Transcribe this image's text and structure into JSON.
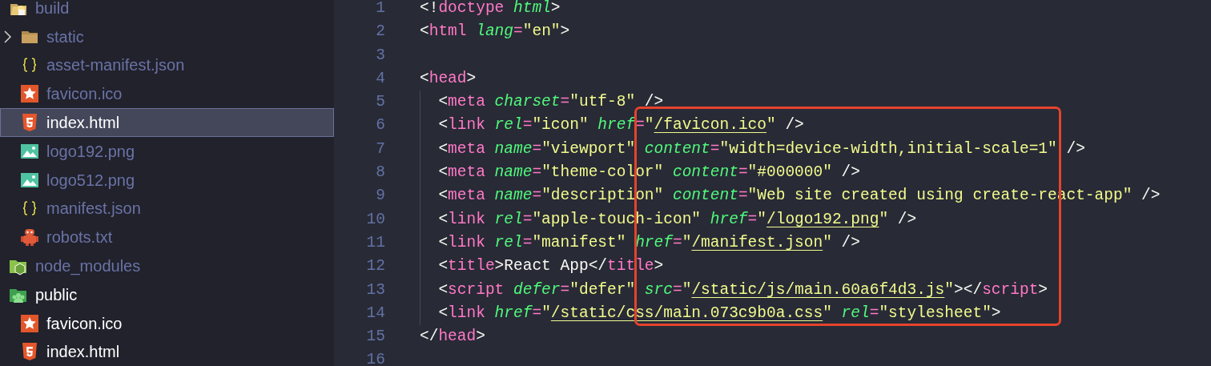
{
  "sidebar": {
    "items": [
      {
        "label": "build",
        "kind": "build-folder",
        "dimmed": true,
        "selected": false,
        "children": [
          {
            "label": "static",
            "kind": "folder",
            "dimmed": true,
            "selected": false,
            "expanded": false
          },
          {
            "label": "asset-manifest.json",
            "kind": "json",
            "dimmed": true,
            "selected": false
          },
          {
            "label": "favicon.ico",
            "kind": "star",
            "dimmed": true,
            "selected": false
          },
          {
            "label": "index.html",
            "kind": "html",
            "dimmed": false,
            "selected": true
          },
          {
            "label": "logo192.png",
            "kind": "image",
            "dimmed": true,
            "selected": false
          },
          {
            "label": "logo512.png",
            "kind": "image",
            "dimmed": true,
            "selected": false
          },
          {
            "label": "manifest.json",
            "kind": "json",
            "dimmed": true,
            "selected": false
          },
          {
            "label": "robots.txt",
            "kind": "robot",
            "dimmed": true,
            "selected": false
          }
        ]
      },
      {
        "label": "node_modules",
        "kind": "node-folder",
        "dimmed": true,
        "selected": false
      },
      {
        "label": "public",
        "kind": "public-folder",
        "dimmed": false,
        "selected": false,
        "children": [
          {
            "label": "favicon.ico",
            "kind": "star",
            "dimmed": false,
            "selected": false
          },
          {
            "label": "index.html",
            "kind": "html",
            "dimmed": false,
            "selected": false
          }
        ]
      }
    ]
  },
  "editor": {
    "lines": [
      {
        "number": "1",
        "indented": false,
        "tokens": [
          {
            "kind": "punct",
            "text": "<!"
          },
          {
            "kind": "tag",
            "text": "doctype"
          },
          {
            "kind": "attr",
            "text": " html"
          },
          {
            "kind": "punct",
            "text": ">"
          }
        ]
      },
      {
        "number": "2",
        "indented": false,
        "tokens": [
          {
            "kind": "punct",
            "text": "<"
          },
          {
            "kind": "tag",
            "text": "html"
          },
          {
            "kind": "attr",
            "text": " lang"
          },
          {
            "kind": "tag",
            "text": "="
          },
          {
            "kind": "string",
            "text": "\"en\""
          },
          {
            "kind": "punct",
            "text": ">"
          }
        ]
      },
      {
        "number": "3",
        "indented": false
      },
      {
        "number": "4",
        "indented": false,
        "tokens": [
          {
            "kind": "punct",
            "text": "<"
          },
          {
            "kind": "tag",
            "text": "head"
          },
          {
            "kind": "punct",
            "text": ">"
          }
        ]
      },
      {
        "number": "5",
        "indented": true,
        "tokens": [
          {
            "kind": "punct",
            "text": "<"
          },
          {
            "kind": "tag",
            "text": "meta"
          },
          {
            "kind": "attr",
            "text": " charset"
          },
          {
            "kind": "tag",
            "text": "="
          },
          {
            "kind": "string",
            "text": "\"utf-8\""
          },
          {
            "kind": "punct",
            "text": " />"
          }
        ]
      },
      {
        "number": "6",
        "indented": true,
        "tokens": [
          {
            "kind": "punct",
            "text": "<"
          },
          {
            "kind": "tag",
            "text": "link"
          },
          {
            "kind": "attr",
            "text": " rel"
          },
          {
            "kind": "tag",
            "text": "="
          },
          {
            "kind": "string",
            "text": "\"icon\""
          },
          {
            "kind": "attr",
            "text": " href"
          },
          {
            "kind": "tag",
            "text": "="
          },
          {
            "kind": "string",
            "text": "\""
          },
          {
            "kind": "link",
            "text": "/favicon.ico"
          },
          {
            "kind": "string",
            "text": "\""
          },
          {
            "kind": "punct",
            "text": " />"
          }
        ]
      },
      {
        "number": "7",
        "indented": true,
        "tokens": [
          {
            "kind": "punct",
            "text": "<"
          },
          {
            "kind": "tag",
            "text": "meta"
          },
          {
            "kind": "attr",
            "text": " name"
          },
          {
            "kind": "tag",
            "text": "="
          },
          {
            "kind": "string",
            "text": "\"viewport\""
          },
          {
            "kind": "attr",
            "text": " content"
          },
          {
            "kind": "tag",
            "text": "="
          },
          {
            "kind": "string",
            "text": "\"width=device-width,initial-scale=1\""
          },
          {
            "kind": "punct",
            "text": " />"
          }
        ]
      },
      {
        "number": "8",
        "indented": true,
        "tokens": [
          {
            "kind": "punct",
            "text": "<"
          },
          {
            "kind": "tag",
            "text": "meta"
          },
          {
            "kind": "attr",
            "text": " name"
          },
          {
            "kind": "tag",
            "text": "="
          },
          {
            "kind": "string",
            "text": "\"theme-color\""
          },
          {
            "kind": "attr",
            "text": " content"
          },
          {
            "kind": "tag",
            "text": "="
          },
          {
            "kind": "string",
            "text": "\"#000000\""
          },
          {
            "kind": "punct",
            "text": " />"
          }
        ]
      },
      {
        "number": "9",
        "indented": true,
        "tokens": [
          {
            "kind": "punct",
            "text": "<"
          },
          {
            "kind": "tag",
            "text": "meta"
          },
          {
            "kind": "attr",
            "text": " name"
          },
          {
            "kind": "tag",
            "text": "="
          },
          {
            "kind": "string",
            "text": "\"description\""
          },
          {
            "kind": "attr",
            "text": " content"
          },
          {
            "kind": "tag",
            "text": "="
          },
          {
            "kind": "string",
            "text": "\"Web site created using create-react-app\""
          },
          {
            "kind": "punct",
            "text": " />"
          }
        ]
      },
      {
        "number": "10",
        "indented": true,
        "tokens": [
          {
            "kind": "punct",
            "text": "<"
          },
          {
            "kind": "tag",
            "text": "link"
          },
          {
            "kind": "attr",
            "text": " rel"
          },
          {
            "kind": "tag",
            "text": "="
          },
          {
            "kind": "string",
            "text": "\"apple-touch-icon\""
          },
          {
            "kind": "attr",
            "text": " href"
          },
          {
            "kind": "tag",
            "text": "="
          },
          {
            "kind": "string",
            "text": "\""
          },
          {
            "kind": "link",
            "text": "/logo192.png"
          },
          {
            "kind": "string",
            "text": "\""
          },
          {
            "kind": "punct",
            "text": " />"
          }
        ]
      },
      {
        "number": "11",
        "indented": true,
        "tokens": [
          {
            "kind": "punct",
            "text": "<"
          },
          {
            "kind": "tag",
            "text": "link"
          },
          {
            "kind": "attr",
            "text": " rel"
          },
          {
            "kind": "tag",
            "text": "="
          },
          {
            "kind": "string",
            "text": "\"manifest\""
          },
          {
            "kind": "attr",
            "text": " href"
          },
          {
            "kind": "tag",
            "text": "="
          },
          {
            "kind": "string",
            "text": "\""
          },
          {
            "kind": "link",
            "text": "/manifest.json"
          },
          {
            "kind": "string",
            "text": "\""
          },
          {
            "kind": "punct",
            "text": " />"
          }
        ]
      },
      {
        "number": "12",
        "indented": true,
        "tokens": [
          {
            "kind": "punct",
            "text": "<"
          },
          {
            "kind": "tag",
            "text": "title"
          },
          {
            "kind": "punct",
            "text": ">React App</"
          },
          {
            "kind": "tag",
            "text": "title"
          },
          {
            "kind": "punct",
            "text": ">"
          }
        ]
      },
      {
        "number": "13",
        "indented": true,
        "tokens": [
          {
            "kind": "punct",
            "text": "<"
          },
          {
            "kind": "tag",
            "text": "script"
          },
          {
            "kind": "attr",
            "text": " defer"
          },
          {
            "kind": "tag",
            "text": "="
          },
          {
            "kind": "string",
            "text": "\"defer\""
          },
          {
            "kind": "attr",
            "text": " src"
          },
          {
            "kind": "tag",
            "text": "="
          },
          {
            "kind": "string",
            "text": "\""
          },
          {
            "kind": "link",
            "text": "/static/js/main.60a6f4d3.js"
          },
          {
            "kind": "string",
            "text": "\""
          },
          {
            "kind": "punct",
            "text": "></"
          },
          {
            "kind": "tag",
            "text": "script"
          },
          {
            "kind": "punct",
            "text": ">"
          }
        ]
      },
      {
        "number": "14",
        "indented": true,
        "tokens": [
          {
            "kind": "punct",
            "text": "<"
          },
          {
            "kind": "tag",
            "text": "link"
          },
          {
            "kind": "attr",
            "text": " href"
          },
          {
            "kind": "tag",
            "text": "="
          },
          {
            "kind": "string",
            "text": "\""
          },
          {
            "kind": "link",
            "text": "/static/css/main.073c9b0a.css"
          },
          {
            "kind": "string",
            "text": "\""
          },
          {
            "kind": "attr",
            "text": " rel"
          },
          {
            "kind": "tag",
            "text": "="
          },
          {
            "kind": "string",
            "text": "\"stylesheet\""
          },
          {
            "kind": "punct",
            "text": ">"
          }
        ]
      },
      {
        "number": "15",
        "indented": false,
        "tokens": [
          {
            "kind": "punct",
            "text": "</"
          },
          {
            "kind": "tag",
            "text": "head"
          },
          {
            "kind": "punct",
            "text": ">"
          }
        ]
      },
      {
        "number": "16",
        "indented": false
      }
    ],
    "highlight": {
      "kind": "box",
      "color": "#e5432d"
    }
  }
}
